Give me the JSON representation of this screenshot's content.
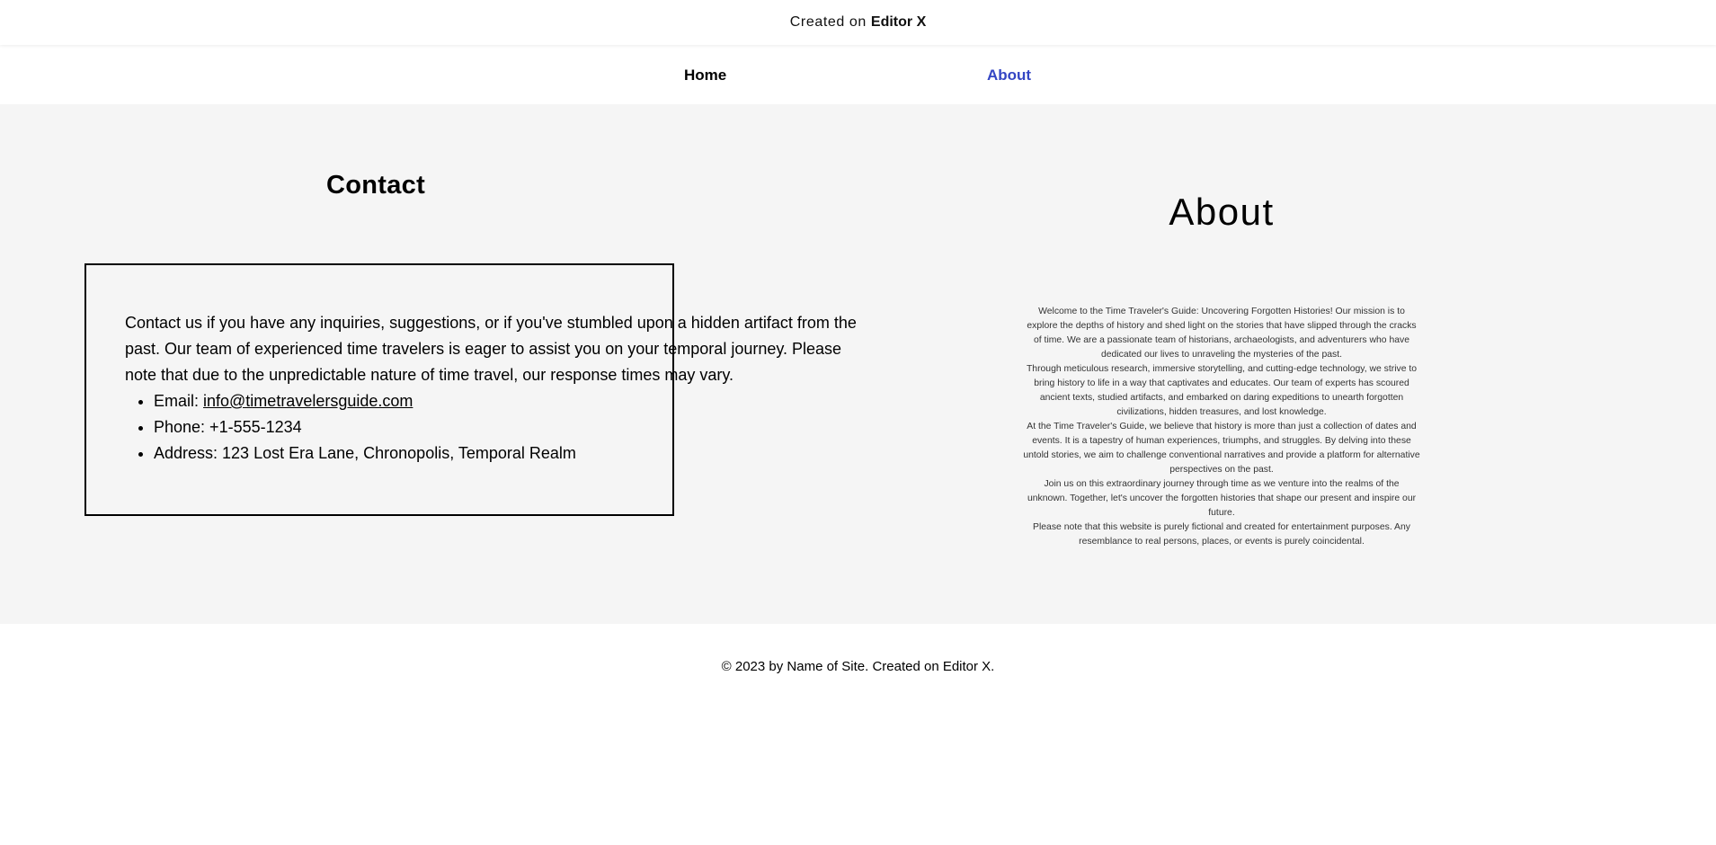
{
  "topbar": {
    "prefix": "Created on",
    "brand": "Editor X"
  },
  "nav": {
    "items": [
      {
        "label": "Home"
      },
      {
        "label": "About"
      }
    ]
  },
  "contact": {
    "title": "Contact",
    "intro": "Contact us if you have any inquiries, suggestions, or if you've stumbled upon a hidden artifact from the past. Our team of experienced time travelers is eager to assist you on your temporal journey. Please note that due to the unpredictable nature of time travel, our response times may vary.",
    "email_label": "Email: ",
    "email": "info@timetravelersguide.com",
    "phone": "Phone: +1-555-1234",
    "address": "Address: 123 Lost Era Lane, Chronopolis, Temporal Realm"
  },
  "about": {
    "title": "About",
    "paragraphs": [
      "Welcome to the Time Traveler's Guide: Uncovering Forgotten Histories! Our mission is to explore the depths of history and shed light on the stories that have slipped through the cracks of time. We are a passionate team of historians, archaeologists, and adventurers who have dedicated our lives to unraveling the mysteries of the past.",
      "Through meticulous research, immersive storytelling, and cutting-edge technology, we strive to bring history to life in a way that captivates and educates. Our team of experts has scoured ancient texts, studied artifacts, and embarked on daring expeditions to unearth forgotten civilizations, hidden treasures, and lost knowledge.",
      "At the Time Traveler's Guide, we believe that history is more than just a collection of dates and events. It is a tapestry of human experiences, triumphs, and struggles. By delving into these untold stories, we aim to challenge conventional narratives and provide a platform for alternative perspectives on the past.",
      "Join us on this extraordinary journey through time as we venture into the realms of the unknown. Together, let's uncover the forgotten histories that shape our present and inspire our future.",
      "Please note that this website is purely fictional and created for entertainment purposes. Any resemblance to real persons, places, or events is purely coincidental."
    ]
  },
  "footer": {
    "text": "© 2023 by Name of Site. Created on Editor X."
  }
}
